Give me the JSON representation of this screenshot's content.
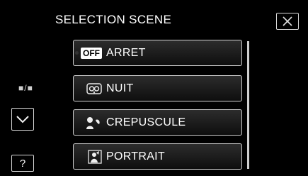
{
  "header": {
    "title": "SELECTION SCENE"
  },
  "sidebar": {
    "toggle_label": "■/■",
    "help_label": "?"
  },
  "menu": {
    "items": [
      {
        "label": "ARRET",
        "badge": "OFF",
        "icon": "off-icon"
      },
      {
        "label": "NUIT",
        "icon": "owl-icon"
      },
      {
        "label": "CREPUSCULE",
        "icon": "sunset-icon"
      },
      {
        "label": "PORTRAIT",
        "icon": "portrait-icon"
      }
    ]
  }
}
